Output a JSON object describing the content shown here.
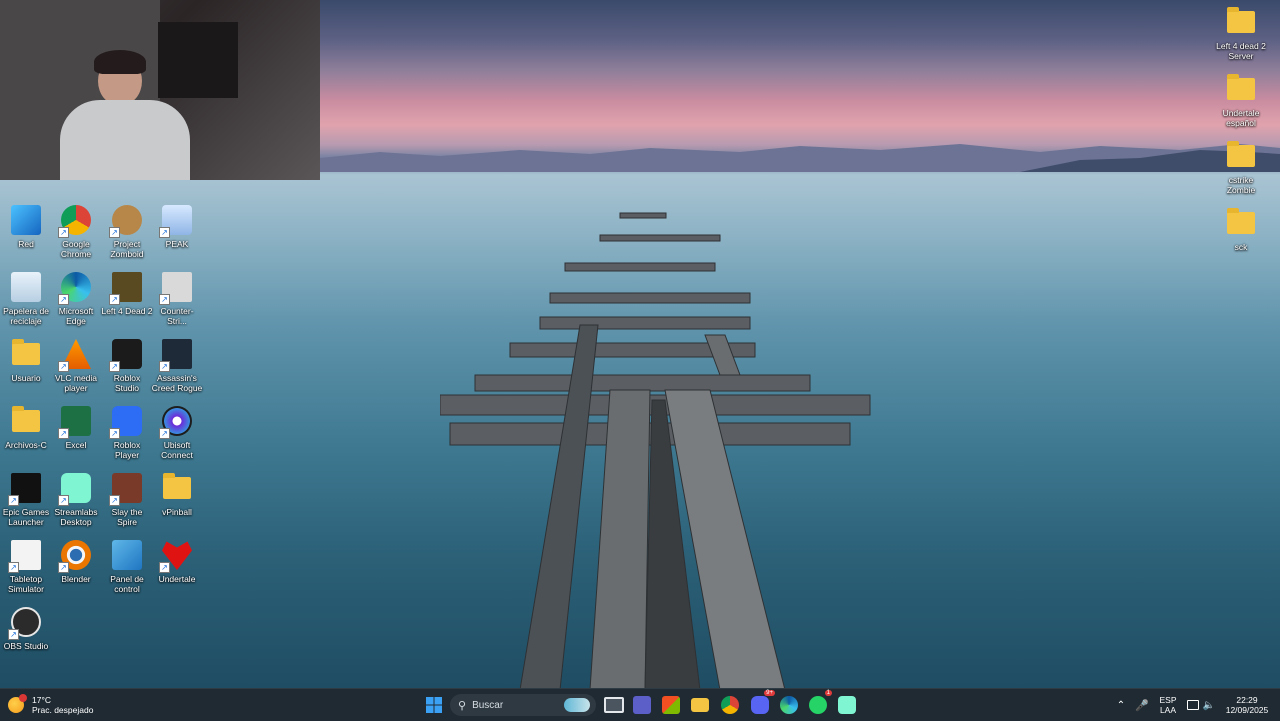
{
  "desktop": {
    "left_icons": [
      {
        "id": "red",
        "label": "Red",
        "icon": "network-icon"
      },
      {
        "id": "chrome",
        "label": "Google Chrome",
        "icon": "chrome-icon"
      },
      {
        "id": "zomboid",
        "label": "Project Zomboid",
        "icon": "zomboid-icon"
      },
      {
        "id": "peak",
        "label": "PEAK",
        "icon": "peak-icon"
      },
      {
        "id": "recycle",
        "label": "Papelera de reciclaje",
        "icon": "recycle-bin-icon"
      },
      {
        "id": "edge",
        "label": "Microsoft Edge",
        "icon": "edge-icon"
      },
      {
        "id": "l4d2",
        "label": "Left 4 Dead 2",
        "icon": "l4d2-icon"
      },
      {
        "id": "cs",
        "label": "Counter-Stri...",
        "icon": "counter-strike-icon"
      },
      {
        "id": "usuario",
        "label": "Usuario",
        "icon": "folder-icon"
      },
      {
        "id": "vlc",
        "label": "VLC media player",
        "icon": "vlc-icon"
      },
      {
        "id": "roblox-studio",
        "label": "Roblox Studio",
        "icon": "roblox-studio-icon"
      },
      {
        "id": "ac-rogue",
        "label": "Assassin's Creed Rogue",
        "icon": "assassins-creed-icon"
      },
      {
        "id": "archivos",
        "label": "Archivos-C",
        "icon": "folder-icon"
      },
      {
        "id": "excel",
        "label": "Excel",
        "icon": "excel-icon"
      },
      {
        "id": "roblox-player",
        "label": "Roblox Player",
        "icon": "roblox-player-icon"
      },
      {
        "id": "ubisoft",
        "label": "Ubisoft Connect",
        "icon": "ubisoft-icon"
      },
      {
        "id": "epic",
        "label": "Epic Games Launcher",
        "icon": "epic-games-icon"
      },
      {
        "id": "streamlabs",
        "label": "Streamlabs Desktop",
        "icon": "streamlabs-icon"
      },
      {
        "id": "sts",
        "label": "Slay the Spire",
        "icon": "slay-the-spire-icon"
      },
      {
        "id": "vpinball",
        "label": "vPinball",
        "icon": "folder-icon"
      },
      {
        "id": "tabletop",
        "label": "Tabletop Simulator",
        "icon": "tabletop-icon"
      },
      {
        "id": "blender",
        "label": "Blender",
        "icon": "blender-icon"
      },
      {
        "id": "panel",
        "label": "Panel de control",
        "icon": "control-panel-icon"
      },
      {
        "id": "undertale",
        "label": "Undertale",
        "icon": "undertale-heart-icon"
      },
      {
        "id": "obs",
        "label": "OBS Studio",
        "icon": "obs-icon"
      }
    ],
    "right_icons": [
      {
        "id": "l4d2-server",
        "label": "Left 4 dead 2 Server",
        "icon": "folder-icon"
      },
      {
        "id": "undertale-es",
        "label": "Undertale español",
        "icon": "folder-icon"
      },
      {
        "id": "cstrike",
        "label": "cstrike Zombie",
        "icon": "folder-icon"
      },
      {
        "id": "sck",
        "label": "sck",
        "icon": "folder-icon"
      }
    ]
  },
  "taskbar": {
    "weather": {
      "temp": "17°C",
      "desc": "Prac. despejado"
    },
    "search_placeholder": "Buscar",
    "apps": [
      {
        "name": "start-button",
        "icon": "windows-icon"
      },
      {
        "name": "task-view",
        "icon": "task-view-icon"
      },
      {
        "name": "teams",
        "icon": "teams-icon"
      },
      {
        "name": "store",
        "icon": "store-icon"
      },
      {
        "name": "explorer",
        "icon": "folder-icon"
      },
      {
        "name": "chrome",
        "icon": "chrome-icon"
      },
      {
        "name": "discord",
        "icon": "discord-icon",
        "badge": "9+"
      },
      {
        "name": "edge",
        "icon": "edge-icon"
      },
      {
        "name": "whatsapp",
        "icon": "whatsapp-icon",
        "badge": "1"
      },
      {
        "name": "streamlabs",
        "icon": "streamlabs-icon"
      }
    ],
    "tray": {
      "lang_top": "ESP",
      "lang_bottom": "LAA",
      "time": "22:29",
      "date": "12/09/2025"
    }
  },
  "colors": {
    "taskbar": "#1f2a33",
    "folder": "#f4c542",
    "accent": "#0078d4"
  }
}
